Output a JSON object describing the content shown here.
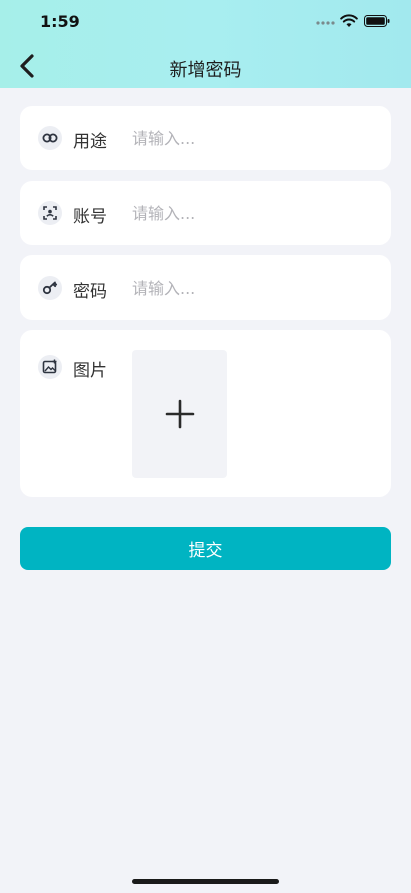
{
  "status_bar": {
    "time": "1:59",
    "signal_icon": "signal-dots-icon",
    "wifi_icon": "wifi-icon",
    "battery_icon": "battery-icon"
  },
  "nav": {
    "back_icon": "chevron-left-icon",
    "title": "新增密码"
  },
  "form": {
    "purpose": {
      "icon": "link-icon",
      "label": "用途",
      "placeholder": "请输入...",
      "value": ""
    },
    "account": {
      "icon": "scan-icon",
      "label": "账号",
      "placeholder": "请输入...",
      "value": ""
    },
    "password": {
      "icon": "key-icon",
      "label": "密码",
      "placeholder": "请输入...",
      "value": ""
    },
    "image": {
      "icon": "image-add-icon",
      "label": "图片",
      "upload_icon": "plus-icon"
    }
  },
  "submit_label": "提交",
  "colors": {
    "header_gradient_start": "#A6EFE9",
    "header_gradient_end": "#A2E9EE",
    "accent": "#00B4C2",
    "background": "#F2F3F8",
    "card": "#FFFFFF",
    "placeholder": "#B3B3B8"
  }
}
